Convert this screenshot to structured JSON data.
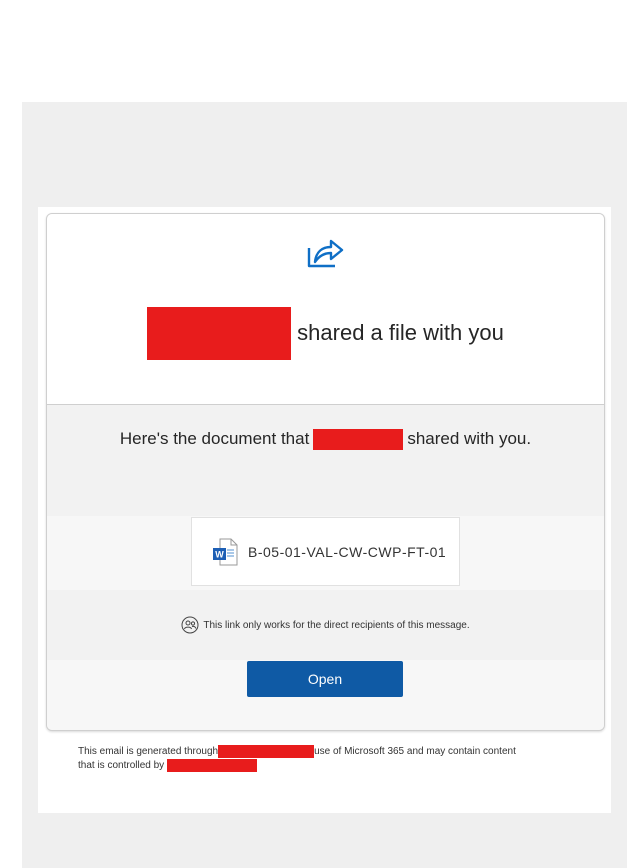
{
  "email": {
    "icon": "share-arrow-icon",
    "headline": "shared a file with you",
    "subline_before": "Here's the document that",
    "subline_after": "shared with you.",
    "file": {
      "icon": "word-document-icon",
      "name": "B-05-01-VAL-CW-CWP-FT-01"
    },
    "notice": {
      "icon": "people-link-icon",
      "text": "This link only works for the direct recipients of this message."
    },
    "open_label": "Open",
    "footer": {
      "part1": "This email is generated through",
      "part2": "use of Microsoft 365 and may contain content",
      "part3": "that is controlled by"
    },
    "colors": {
      "accent": "#0f5aa5",
      "redaction": "#e81c1c"
    }
  }
}
